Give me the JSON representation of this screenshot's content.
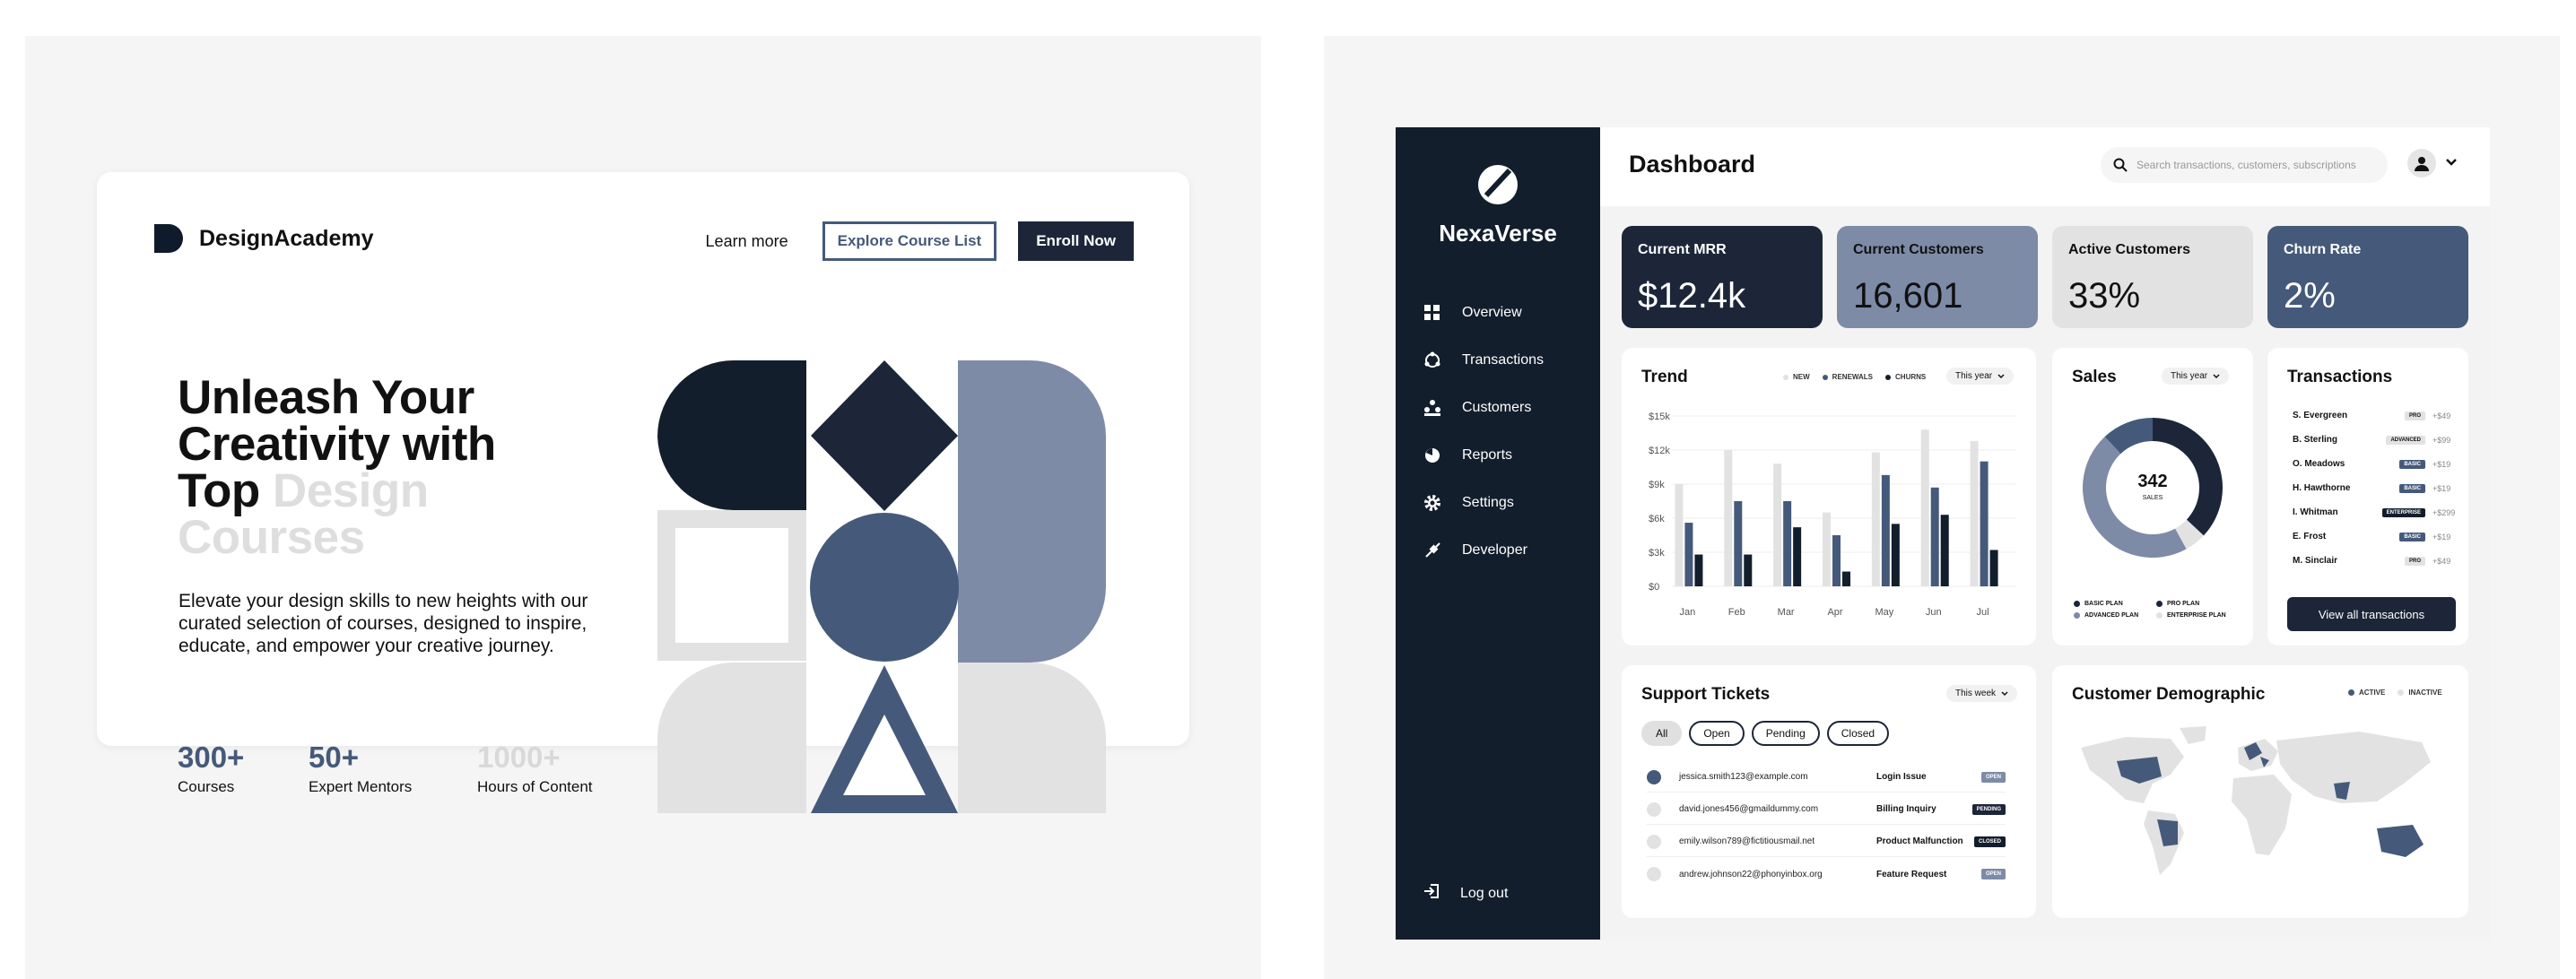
{
  "landing": {
    "brand": "DesignAcademy",
    "nav": {
      "learn_more": "Learn more",
      "explore": "Explore Course List",
      "enroll": "Enroll Now"
    },
    "headline": {
      "line1": "Unleash Your",
      "line2": "Creativity with",
      "line3_dark": "Top ",
      "line3_muted": "Design",
      "line4_muted": "Courses"
    },
    "description": "Elevate your design skills to new heights with our curated selection of courses, designed to inspire, educate, and empower your creative journey.",
    "stats": [
      {
        "value": "300+",
        "label": "Courses"
      },
      {
        "value": "50+",
        "label": "Expert Mentors"
      },
      {
        "value": "1000+",
        "label": "Hours of Content"
      }
    ]
  },
  "dashboard": {
    "brand": "NexaVerse",
    "menu": [
      "Overview",
      "Transactions",
      "Customers",
      "Reports",
      "Settings",
      "Developer"
    ],
    "logout": "Log out",
    "title": "Dashboard",
    "search_placeholder": "Search transactions, customers, subscriptions",
    "kpis": [
      {
        "label": "Current MRR",
        "value": "$12.4k",
        "bg": "#1c2638",
        "fg": "#ffffff"
      },
      {
        "label": "Current Customers",
        "value": "16,601",
        "bg": "#7d8ba7",
        "fg": "#111111"
      },
      {
        "label": "Active Customers",
        "value": "33%",
        "bg": "#e2e2e2",
        "fg": "#111111"
      },
      {
        "label": "Churn Rate",
        "value": "2%",
        "bg": "#455a7a",
        "fg": "#ffffff"
      }
    ],
    "trend": {
      "title": "Trend",
      "filter": "This year",
      "legend": [
        "NEW",
        "RENEWALS",
        "CHURNS"
      ]
    },
    "sales": {
      "title": "Sales",
      "filter": "This year",
      "center_value": "342",
      "center_label": "SALES",
      "legend": [
        "BASIC PLAN",
        "PRO PLAN",
        "ADVANCED PLAN",
        "ENTERPRISE PLAN"
      ]
    },
    "transactions": {
      "title": "Transactions",
      "rows": [
        {
          "name": "S. Evergreen",
          "badge": "PRO",
          "amount": "+$49"
        },
        {
          "name": "B. Sterling",
          "badge": "ADVANCED",
          "amount": "+$99"
        },
        {
          "name": "O. Meadows",
          "badge": "BASIC",
          "amount": "+$19"
        },
        {
          "name": "H. Hawthorne",
          "badge": "BASIC",
          "amount": "+$19"
        },
        {
          "name": "I. Whitman",
          "badge": "ENTERPRISE",
          "amount": "+$299"
        },
        {
          "name": "E. Frost",
          "badge": "BASIC",
          "amount": "+$19"
        },
        {
          "name": "M. Sinclair",
          "badge": "PRO",
          "amount": "+$49"
        }
      ],
      "button": "View all transactions"
    },
    "tickets": {
      "title": "Support Tickets",
      "filter": "This week",
      "chips": [
        "All",
        "Open",
        "Pending",
        "Closed"
      ],
      "rows": [
        {
          "email": "jessica.smith123@example.com",
          "issue": "Login Issue",
          "status": "OPEN"
        },
        {
          "email": "david.jones456@gmaildummy.com",
          "issue": "Billing Inquiry",
          "status": "PENDING"
        },
        {
          "email": "emily.wilson789@fictitiousmail.net",
          "issue": "Product Malfunction",
          "status": "CLOSED"
        },
        {
          "email": "andrew.johnson22@phonyinbox.org",
          "issue": "Feature Request",
          "status": "OPEN"
        }
      ]
    },
    "demographic": {
      "title": "Customer Demographic",
      "legend": [
        "ACTIVE",
        "INACTIVE"
      ]
    }
  },
  "chart_data": [
    {
      "type": "bar",
      "categories": [
        "Jan",
        "Feb",
        "Mar",
        "Apr",
        "May",
        "Jun",
        "Jul"
      ],
      "yticks": [
        "$0",
        "$3k",
        "$6k",
        "$9k",
        "$12k",
        "$15k"
      ],
      "ylim": [
        0,
        15000
      ],
      "series": [
        {
          "name": "NEW",
          "color": "#e2e2e2",
          "values": [
            9000,
            12000,
            10800,
            6500,
            11800,
            13800,
            12800
          ]
        },
        {
          "name": "RENEWALS",
          "color": "#455a7a",
          "values": [
            5600,
            7500,
            7500,
            4500,
            9800,
            8700,
            11000
          ]
        },
        {
          "name": "CHURNS",
          "color": "#131e2c",
          "values": [
            2800,
            2800,
            5200,
            1300,
            5500,
            6300,
            3200
          ]
        }
      ]
    },
    {
      "type": "pie",
      "labels": [
        "BASIC PLAN",
        "PRO PLAN",
        "ADVANCED PLAN",
        "ENTERPRISE PLAN"
      ],
      "values": [
        37,
        5,
        46,
        12
      ],
      "colors": [
        "#1c2638",
        "#e2e2e2",
        "#7d8ba7",
        "#455a7a"
      ]
    }
  ]
}
